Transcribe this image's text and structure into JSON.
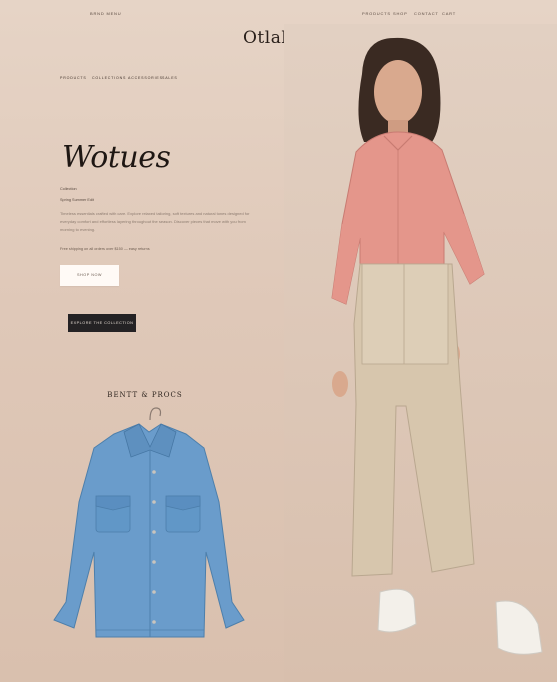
{
  "topbar": {
    "left_items": [
      "",
      "",
      "BRND MENU"
    ],
    "right_items": [
      "PRODUCTS",
      "SHOP",
      "CONTACT",
      "CART"
    ]
  },
  "logo": "Otlabeo",
  "subnav": [
    "PRODUCTS",
    "COLLECTIONS",
    "ACCESSORIES",
    "SALES"
  ],
  "hero": {
    "title": "Wotues",
    "meta_line1": "Collection",
    "meta_line2": "Spring Summer Edit",
    "paragraph": "Timeless essentials crafted with care. Explore relaxed tailoring, soft textures and natural tones designed for everyday comfort and effortless layering throughout the season. Discover pieces that move with you from morning to evening.",
    "small_line": "Free shipping on all orders over $150 — easy returns",
    "button_light": "SHOP NOW",
    "button_dark": "EXPLORE THE COLLECTION"
  },
  "section": {
    "title": "BENTT & PROCS"
  },
  "colors": {
    "background": "#e2cfc1",
    "dark_button": "#242224",
    "shirt": "#e4948a",
    "trousers": "#d8c8b0",
    "denim": "#6c9fcd"
  }
}
